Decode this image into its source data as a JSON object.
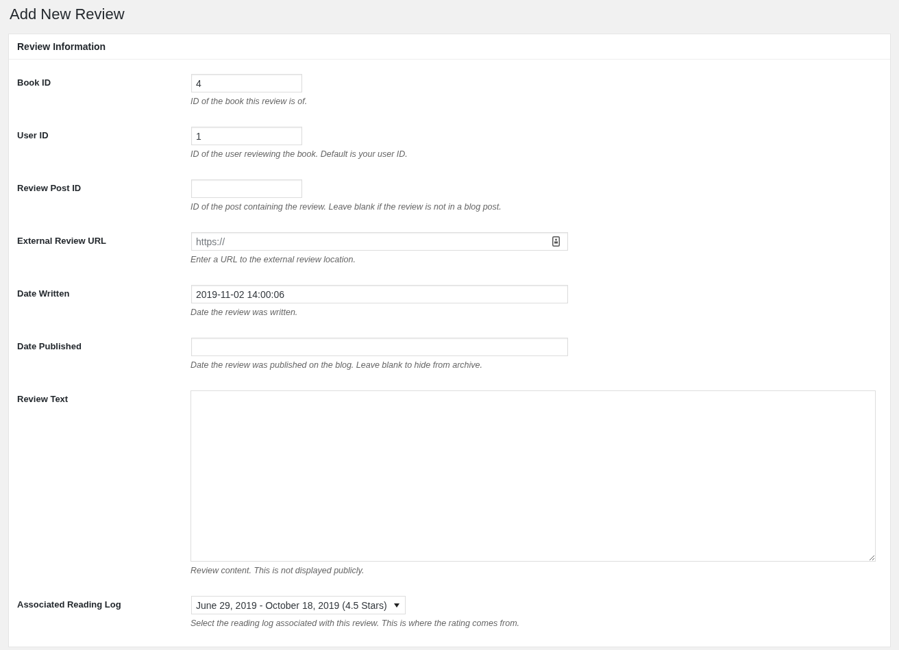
{
  "page_title": "Add New Review",
  "panel": {
    "title": "Review Information",
    "fields": [
      {
        "kind": "short",
        "label": "Book ID",
        "value": "4",
        "hint": "ID of the book this review is of."
      },
      {
        "kind": "short",
        "label": "User ID",
        "value": "1",
        "hint": "ID of the user reviewing the book. Default is your user ID."
      },
      {
        "kind": "short",
        "label": "Review Post ID",
        "hint": "ID of the post containing the review. Leave blank if the review is not in a blog post."
      },
      {
        "kind": "url",
        "label": "External Review URL",
        "placeholder": "https://",
        "hint": "Enter a URL to the external review location."
      },
      {
        "kind": "wide",
        "label": "Date Written",
        "value": "2019-11-02 14:00:06",
        "hint": "Date the review was written."
      },
      {
        "kind": "wide",
        "label": "Date Published",
        "hint": "Date the review was published on the blog. Leave blank to hide from archive."
      },
      {
        "kind": "textarea",
        "label": "Review Text",
        "hint": "Review content. This is not displayed publicly."
      },
      {
        "kind": "select",
        "label": "Associated Reading Log",
        "value": "June 29, 2019 - October 18, 2019 (4.5 Stars)",
        "hint": "Select the reading log associated with this review. This is where the rating comes from."
      }
    ]
  }
}
